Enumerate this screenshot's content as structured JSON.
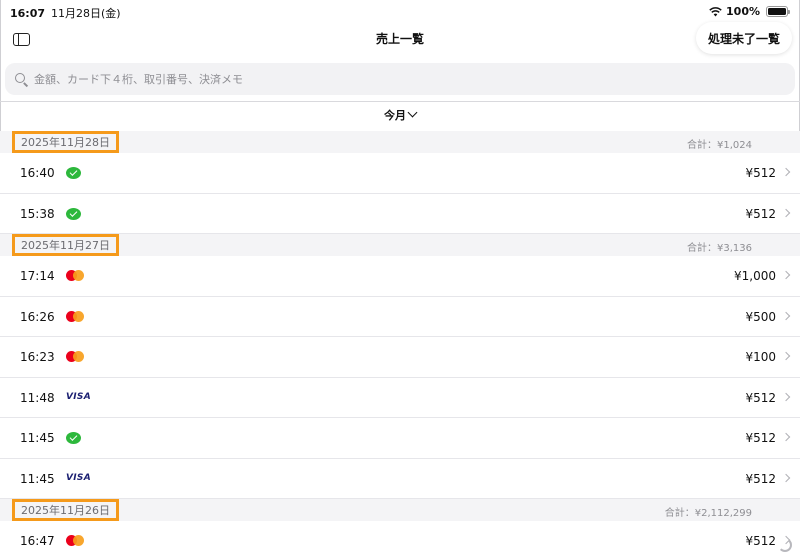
{
  "status_bar": {
    "time": "16:07",
    "date": "11月28日(金)",
    "battery": "100%"
  },
  "nav": {
    "title": "売上一覧",
    "pending_button": "処理未了一覧"
  },
  "search": {
    "placeholder": "金額、カード下４桁、取引番号、決済メモ",
    "value": ""
  },
  "period": {
    "label": "今月"
  },
  "sections": [
    {
      "date": "2025年11月28日",
      "total": "合計：¥1,024",
      "rows": [
        {
          "time": "16:40",
          "payment": "wechat-icon",
          "amount": "¥512"
        },
        {
          "time": "15:38",
          "payment": "wechat-icon",
          "amount": "¥512"
        }
      ]
    },
    {
      "date": "2025年11月27日",
      "total": "合計：¥3,136",
      "rows": [
        {
          "time": "17:14",
          "payment": "mastercard-icon",
          "amount": "¥1,000"
        },
        {
          "time": "16:26",
          "payment": "mastercard-icon",
          "amount": "¥500"
        },
        {
          "time": "16:23",
          "payment": "mastercard-icon",
          "amount": "¥100"
        },
        {
          "time": "11:48",
          "payment": "visa-icon",
          "amount": "¥512"
        },
        {
          "time": "11:45",
          "payment": "wechat-icon",
          "amount": "¥512"
        },
        {
          "time": "11:45",
          "payment": "visa-icon",
          "amount": "¥512"
        }
      ]
    },
    {
      "date": "2025年11月26日",
      "total": "合計：¥2,112,299",
      "rows": [
        {
          "time": "16:47",
          "payment": "mastercard-icon",
          "amount": "¥512"
        }
      ]
    }
  ],
  "icon_labels": {
    "visa": "VISA"
  },
  "colors": {
    "highlight_border": "#f59a1b",
    "wechat": "#2db83c",
    "mastercard_red": "#eb001b",
    "mastercard_orange": "#f79e1b",
    "visa": "#1a1f71"
  }
}
